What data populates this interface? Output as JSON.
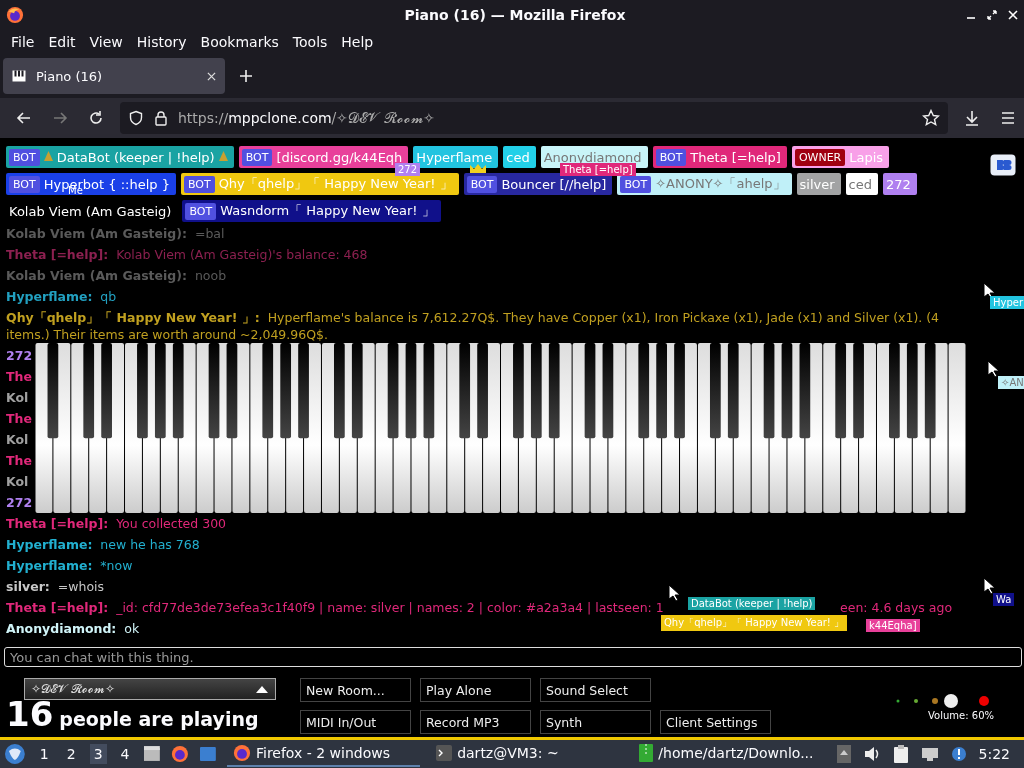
{
  "window": {
    "title": "Piano (16) — Mozilla Firefox"
  },
  "menu": [
    "File",
    "Edit",
    "View",
    "History",
    "Bookmarks",
    "Tools",
    "Help"
  ],
  "tabs": [
    {
      "label": "Piano (16)",
      "selected": true
    }
  ],
  "address": {
    "scheme": "https://",
    "domain": "mppclone.com",
    "path": "/✧𝓓𝓔𝓥 𝓡𝓸𝓸𝓶✧"
  },
  "participants": [
    {
      "label": "DataBot (keeper | !help)",
      "badge": "BOT",
      "color": "#1aa3a3",
      "trees": true
    },
    {
      "label": "[discord.gg/k44Eqh",
      "badge": "BOT",
      "color": "#e8409a"
    },
    {
      "label": "Hyperflame",
      "color": "#22c4e0"
    },
    {
      "label": "ced",
      "color": "#22d0e8"
    },
    {
      "label": "Anonydiamond",
      "color": "#c8f4f8"
    },
    {
      "label": "Theta [=help]",
      "badge": "BOT",
      "color": "#e0287a"
    },
    {
      "label": "Lapis",
      "badge": "OWNER",
      "color": "#f8a0e8"
    },
    {
      "label": "Hyperbot { ::help }",
      "badge": "BOT",
      "color": "#1a40e8"
    },
    {
      "label": "Qhy「qhelp」「 Happy New Year! 」",
      "badge": "BOT",
      "color": "#f0c810"
    },
    {
      "label": "Bouncer [//help]",
      "badge": "BOT",
      "color": "#2828a0",
      "crown": true
    },
    {
      "label": "✧ANONY✧「ahelp」",
      "badge": "BOT",
      "color": "#c0f0f8"
    },
    {
      "label": "silver",
      "color": "#a2a3a4"
    },
    {
      "label": "ced",
      "color": "#ffffff"
    },
    {
      "label": "272",
      "color": "#b080f0"
    },
    {
      "label": "Kolab Viem (Am Gasteig)",
      "color": "#000000",
      "me": "Me"
    },
    {
      "label": "Wasndorm「 Happy New Year! 」",
      "badge": "BOT",
      "color": "#10108a"
    }
  ],
  "chat": [
    {
      "name": "Kolab Viem (Am Gasteig):",
      "message": "=bal",
      "color": "#5a5a5a"
    },
    {
      "name": "Theta [=help]:",
      "message": "Kolab Viem (Am Gasteig)'s balance: 468",
      "color": "#8c2050"
    },
    {
      "name": "Kolab Viem (Am Gasteig):",
      "message": "noob",
      "color": "#5a5a5a"
    },
    {
      "name": "Hyperflame:",
      "message": "qb",
      "color": "#22a0c0"
    },
    {
      "name": "Qhy「qhelp」「 Happy New Year! 」:",
      "message": "Hyperflame's balance is 7,612.27Q$. They have Copper (x1), Iron Pickaxe (x1), Jade (x1) and Silver (x1). (4 items.) Their items are worth around ~2,049.96Q$.",
      "color": "#c0a020"
    },
    {
      "name": "272",
      "color": "#b080f0"
    },
    {
      "name": "The",
      "color": "#e0287a"
    },
    {
      "name": "Kol",
      "color": "#a0a0a0"
    },
    {
      "name": "The",
      "color": "#e0287a"
    },
    {
      "name": "Kol",
      "color": "#a0a0a0"
    },
    {
      "name": "The",
      "color": "#e0287a"
    },
    {
      "name": "Kol",
      "color": "#a0a0a0"
    },
    {
      "name": "272",
      "color": "#b080f0"
    },
    {
      "name": "Theta [=help]:",
      "message": "You collected 300",
      "color": "#e0287a"
    },
    {
      "name": "Hyperflame:",
      "message": "new he has 768",
      "color": "#22b0d0"
    },
    {
      "name": "Hyperflame:",
      "message": "*now",
      "color": "#22b0d0"
    },
    {
      "name": "silver:",
      "message": "=whois",
      "color": "#c8c8c8"
    },
    {
      "name": "Theta [=help]:",
      "message": "_id: cfd77de3de73efea3c1f40f9 | name: silver | names: 2 | color: #a2a3a4 | lastseen: 1",
      "message_end": "een: 4.6 days ago",
      "color": "#e0287a"
    },
    {
      "name": "Anonydiamond:",
      "message": "ok",
      "color": "#d0f4f8"
    }
  ],
  "cursors": [
    {
      "label": "272",
      "color": "#b080f0"
    },
    {
      "label": "Theta [=help]",
      "color": "#e0287a"
    },
    {
      "label": "Hyper",
      "color": "#22c4e0"
    },
    {
      "label": "✧AN",
      "color": "#c0f0f8"
    },
    {
      "label": "Wa",
      "color": "#10108a"
    },
    {
      "label": "DataBot (keeper | !help)",
      "color": "#1aa3a3"
    },
    {
      "label": "Qhy「qhelp」「 Happy New Year! 」",
      "color": "#f0c810"
    },
    {
      "label": "k44Eqha]",
      "color": "#e8409a"
    }
  ],
  "chat_input": {
    "placeholder": "You can chat with this thing."
  },
  "room": {
    "name": "✧𝓓𝓔𝓥 𝓡𝓸𝓸𝓶✧"
  },
  "players": {
    "count": "16",
    "label": "people are playing"
  },
  "buttons": [
    "New Room...",
    "Play Alone",
    "Sound Select",
    "MIDI In/Out",
    "Record MP3",
    "Synth",
    "Client Settings"
  ],
  "volume": {
    "label": "Volume: 60%"
  },
  "taskbar": {
    "workspaces": [
      {
        "label": "1",
        "selected": false
      },
      {
        "label": "2",
        "selected": false
      },
      {
        "label": "3",
        "selected": true
      },
      {
        "label": "4",
        "selected": false
      }
    ],
    "windows": [
      {
        "label": "Firefox - 2 windows",
        "kind": "browser",
        "selected": true
      },
      {
        "label": "dartz@VM3: ~",
        "kind": "terminal",
        "selected": false
      },
      {
        "label": "/home/dartz/Downlo...",
        "kind": "folder",
        "selected": false
      }
    ],
    "clock": "5:22"
  }
}
